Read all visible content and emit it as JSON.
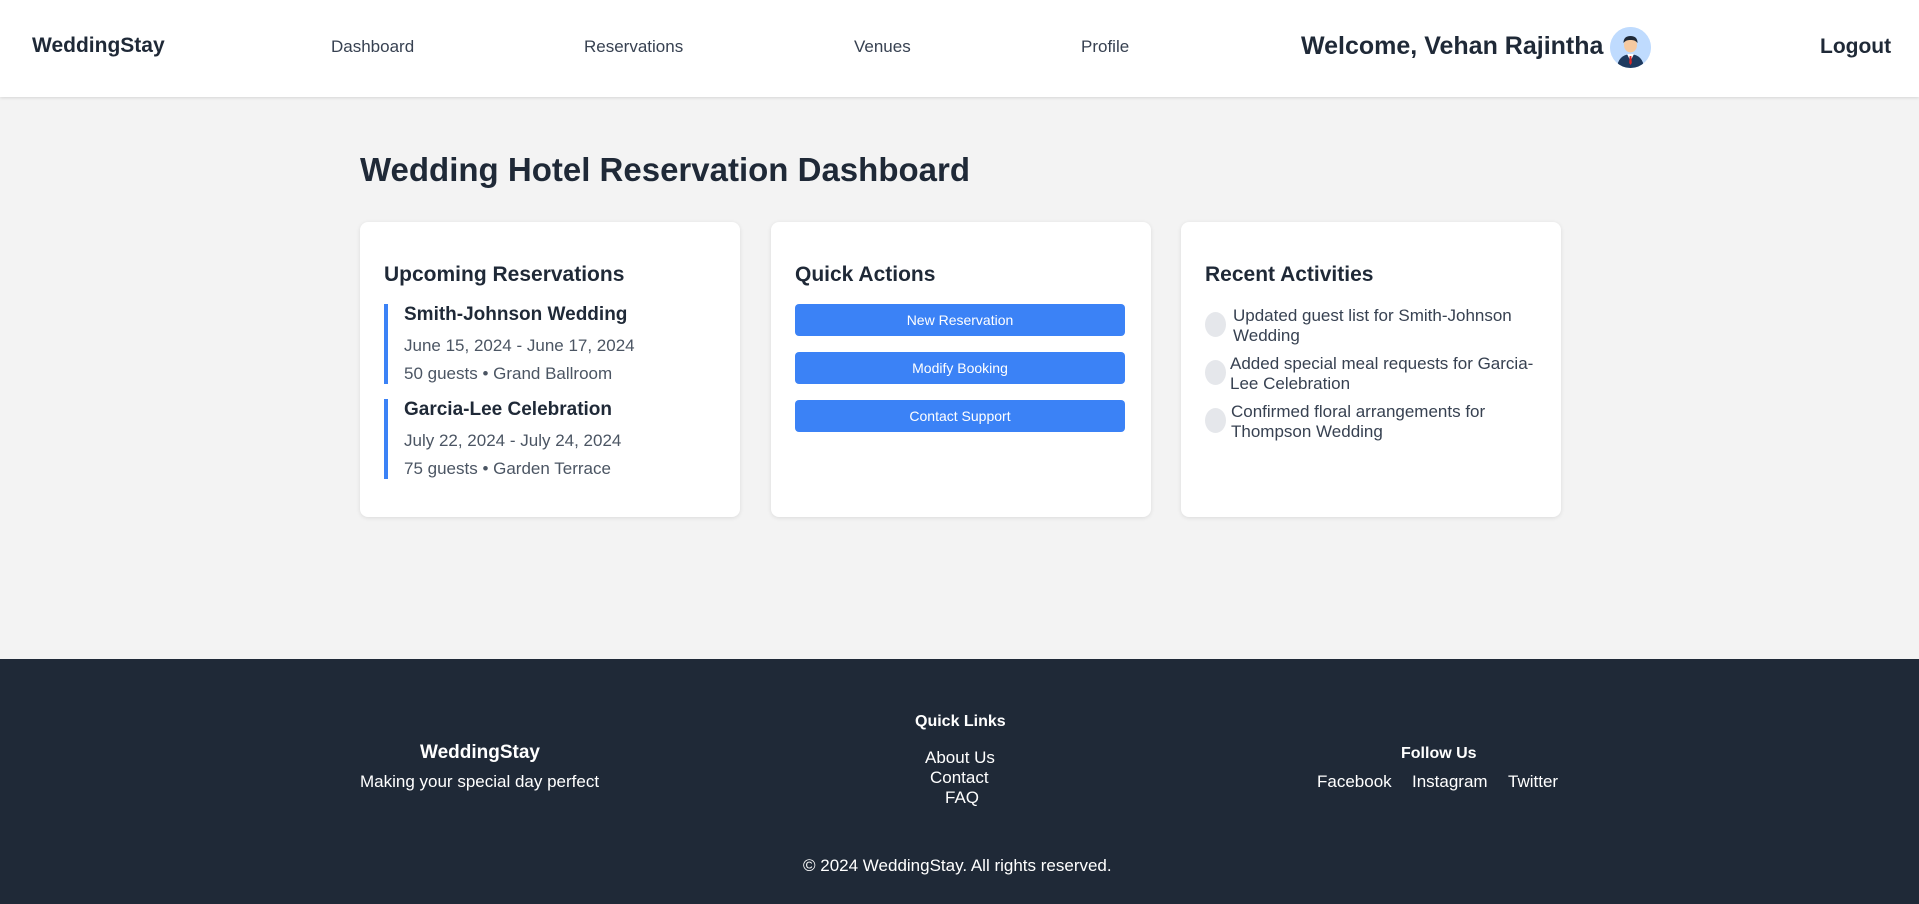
{
  "header": {
    "brand": "WeddingStay",
    "nav": [
      "Dashboard",
      "Reservations",
      "Venues",
      "Profile"
    ],
    "welcome": "Welcome, Vehan Rajintha",
    "logout": "Logout"
  },
  "main": {
    "title": "Wedding Hotel Reservation Dashboard",
    "upcoming": {
      "title": "Upcoming Reservations",
      "items": [
        {
          "name": "Smith-Johnson Wedding",
          "dates": "June 15, 2024 - June 17, 2024",
          "meta": "50 guests • Grand Ballroom"
        },
        {
          "name": "Garcia-Lee Celebration",
          "dates": "July 22, 2024 - July 24, 2024",
          "meta": "75 guests • Garden Terrace"
        }
      ]
    },
    "quick_actions": {
      "title": "Quick Actions",
      "buttons": [
        "New Reservation",
        "Modify Booking",
        "Contact Support"
      ]
    },
    "activities": {
      "title": "Recent Activities",
      "items": [
        {
          "line1": "Updated guest list for Smith-Johnson",
          "line2": "Wedding"
        },
        {
          "line1": "Added special meal requests for Garcia-",
          "line2": "Lee Celebration"
        },
        {
          "line1": "Confirmed floral arrangements for",
          "line2": "Thompson Wedding"
        }
      ]
    }
  },
  "footer": {
    "brand": "WeddingStay",
    "tagline": "Making your special day perfect",
    "quick_links_title": "Quick Links",
    "quick_links": [
      "About Us",
      "Contact",
      "FAQ"
    ],
    "follow_title": "Follow Us",
    "social": [
      "Facebook",
      "Instagram",
      "Twitter"
    ],
    "copyright": "© 2024 WeddingStay. All rights reserved."
  },
  "colors": {
    "accent": "#3b82f6",
    "footer_bg": "#1f2937",
    "page_bg": "#f3f3f3"
  }
}
